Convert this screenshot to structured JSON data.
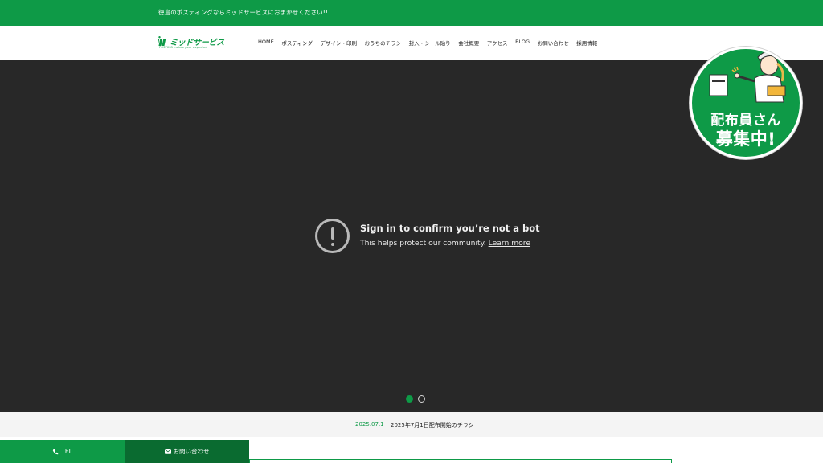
{
  "topbar": {
    "tagline": "徳島のポスティングならミッドサービスにおまかせください!!"
  },
  "logo": {
    "name": "ミッドサービス",
    "sub": "POSTING makes your expected"
  },
  "nav": {
    "items": [
      "HOME",
      "ポスティング",
      "デザイン・印刷",
      "おうちのチラシ",
      "封入・シール貼り",
      "会社概要",
      "アクセス",
      "BLOG",
      "お問い合わせ",
      "採用情報"
    ]
  },
  "hero": {
    "title": "Sign in to confirm you’re not a bot",
    "desc": "This helps protect our community.",
    "link": "Learn more",
    "slide_count": 2,
    "active_slide": 1
  },
  "badge": {
    "line1": "配布員さん",
    "line2": "募集中!"
  },
  "news": {
    "date": "2025.07.1",
    "text": "2025年7月1日配布開始のチラシ"
  },
  "fixed_bar": {
    "tel_label": "TEL",
    "contact_label": "お問い合わせ"
  },
  "colors": {
    "brand": "#0e9a47",
    "brand_dark": "#0a6b30",
    "hero_bg": "#282828"
  }
}
